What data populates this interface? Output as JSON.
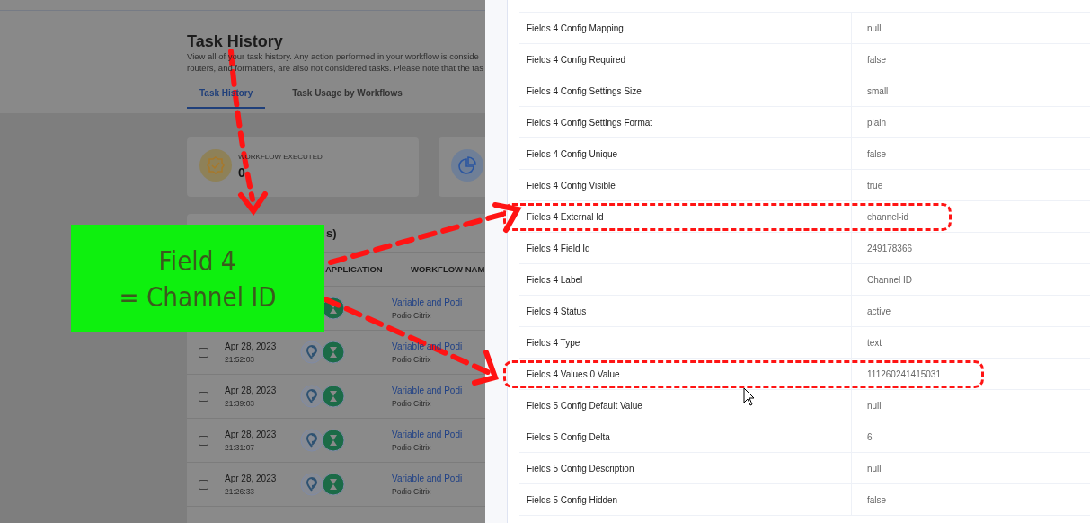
{
  "page": {
    "title": "Task History",
    "description_lines": [
      "View all of your task history. Any action performed in your workflow is conside",
      "routers, and formatters, are also not considered tasks. Please note that the tas"
    ],
    "tabs": [
      {
        "label": "Task History",
        "selected": true
      },
      {
        "label": "Task Usage by Workflows",
        "selected": false
      }
    ],
    "stats": [
      {
        "kind": "badge",
        "label": "WORKFLOW EXECUTED",
        "value": "0"
      },
      {
        "kind": "pie"
      }
    ],
    "table": {
      "title": "s)",
      "columns": [
        "APPLICATION",
        "WORKFLOW NAM"
      ],
      "rows": [
        {
          "workflow": "Variable and Podi",
          "app": "Podio Citrix"
        },
        {
          "checked": false,
          "date": "Apr 28, 2023",
          "time": "21:52:03",
          "workflow": "Variable and Podi",
          "app": "Podio Citrix"
        },
        {
          "checked": false,
          "date": "Apr 28, 2023",
          "time": "21:39:03",
          "workflow": "Variable and Podi",
          "app": "Podio Citrix"
        },
        {
          "checked": false,
          "date": "Apr 28, 2023",
          "time": "21:31:07",
          "workflow": "Variable and Podi",
          "app": "Podio Citrix"
        },
        {
          "checked": false,
          "date": "Apr 28, 2023",
          "time": "21:26:33",
          "workflow": "Variable and Podi",
          "app": "Podio Citrix"
        }
      ]
    }
  },
  "drawer": {
    "rows": [
      {
        "label": "Fields 4 Config Mapping",
        "value": "null",
        "highlighted": false
      },
      {
        "label": "Fields 4 Config Required",
        "value": "false",
        "highlighted": false
      },
      {
        "label": "Fields 4 Config Settings Size",
        "value": "small",
        "highlighted": false
      },
      {
        "label": "Fields 4 Config Settings Format",
        "value": "plain",
        "highlighted": false
      },
      {
        "label": "Fields 4 Config Unique",
        "value": "false",
        "highlighted": false
      },
      {
        "label": "Fields 4 Config Visible",
        "value": "true",
        "highlighted": false
      },
      {
        "label": "Fields 4 External Id",
        "value": "channel-id",
        "highlighted": true
      },
      {
        "label": "Fields 4 Field Id",
        "value": "249178366",
        "highlighted": false
      },
      {
        "label": "Fields 4 Label",
        "value": "Channel ID",
        "highlighted": false
      },
      {
        "label": "Fields 4 Status",
        "value": "active",
        "highlighted": false
      },
      {
        "label": "Fields 4 Type",
        "value": "text",
        "highlighted": false
      },
      {
        "label": "Fields 4 Values 0 Value",
        "value": "111260241415031",
        "highlighted": true
      },
      {
        "label": "Fields 5 Config Default Value",
        "value": "null",
        "highlighted": false
      },
      {
        "label": "Fields 5 Config Delta",
        "value": "6",
        "highlighted": false
      },
      {
        "label": "Fields 5 Config Description",
        "value": "null",
        "highlighted": false
      },
      {
        "label": "Fields 5 Config Hidden",
        "value": "false",
        "highlighted": false
      }
    ]
  },
  "note": {
    "lines": [
      "Field 4",
      "= Channel ID"
    ]
  }
}
